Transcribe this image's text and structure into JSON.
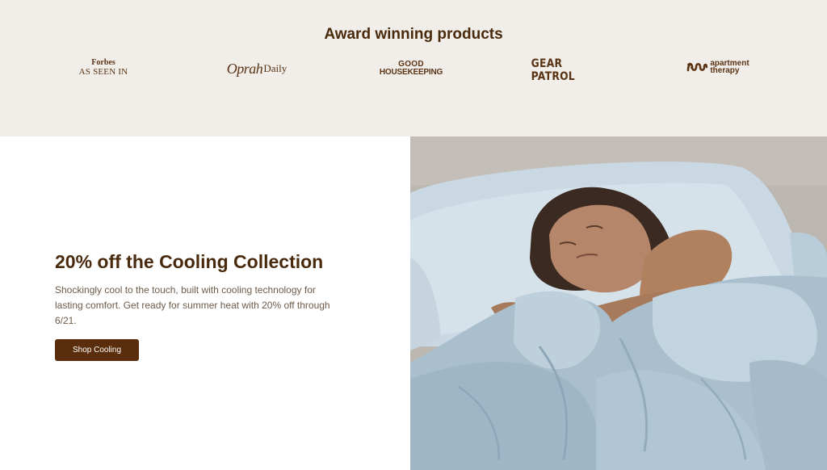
{
  "awards": {
    "title": "Award winning products",
    "logos": {
      "forbes": {
        "line1": "Forbes",
        "line2": "AS SEEN IN"
      },
      "oprah": {
        "script": "Oprah",
        "daily": "Daily"
      },
      "good_housekeeping": {
        "line1": "GOOD",
        "line2": "HOUSEKEEPING"
      },
      "gear_patrol": {
        "text": "GEAR PATROL"
      },
      "apartment_therapy": {
        "line1": "apartment",
        "line2": "therapy"
      }
    }
  },
  "promo": {
    "headline": "20% off the Cooling Collection",
    "body": "Shockingly cool to the touch, built with cooling technology for lasting comfort. Get ready for summer heat with 20% off through 6/21.",
    "button_label": "Shop Cooling"
  },
  "colors": {
    "awards_background": "#f1eee9",
    "brand_brown": "#5a2e0c",
    "body_text": "#6e5a48",
    "sheet_blue": "#b4c7d4"
  }
}
